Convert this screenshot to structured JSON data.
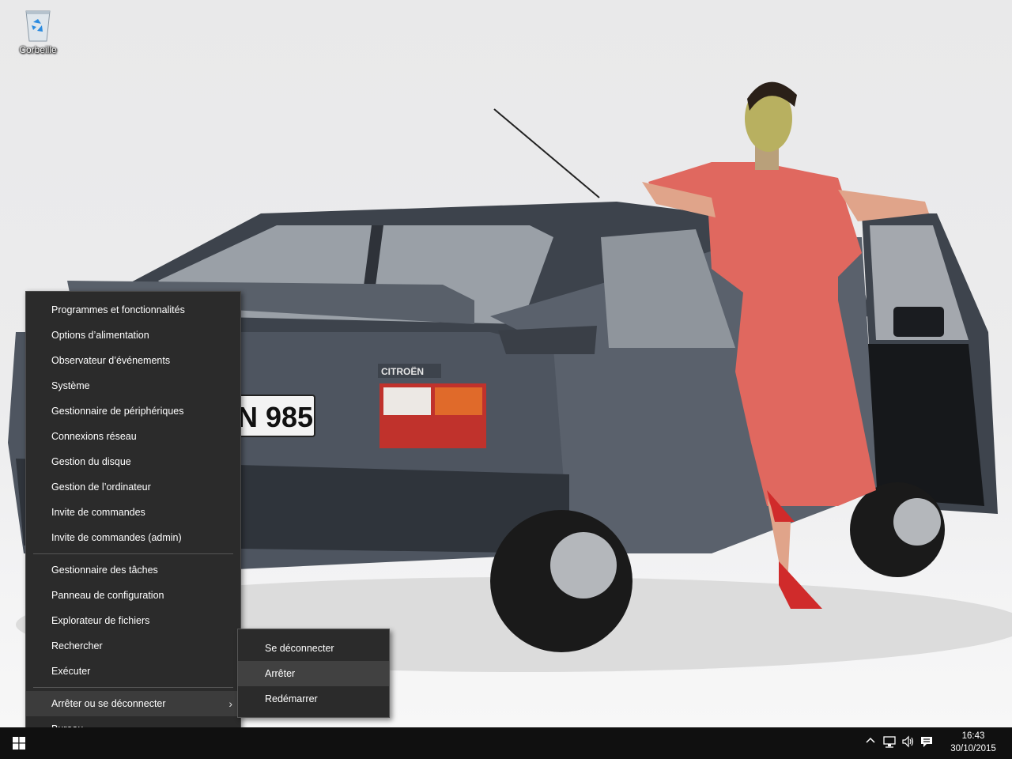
{
  "desktop": {
    "recycle_bin_label": "Corbeille",
    "wallpaper": {
      "car_badge": "CITROËN",
      "license_plate": "N 985"
    }
  },
  "winx_menu": {
    "group1": [
      {
        "label": "Programmes et fonctionnalités"
      },
      {
        "label": "Options d’alimentation"
      },
      {
        "label": "Observateur d’événements"
      },
      {
        "label": "Système"
      },
      {
        "label": "Gestionnaire de périphériques"
      },
      {
        "label": "Connexions réseau"
      },
      {
        "label": "Gestion du disque"
      },
      {
        "label": "Gestion de l’ordinateur"
      },
      {
        "label": "Invite de commandes"
      },
      {
        "label": "Invite de commandes (admin)"
      }
    ],
    "group2": [
      {
        "label": "Gestionnaire des tâches"
      },
      {
        "label": "Panneau de configuration"
      },
      {
        "label": "Explorateur de fichiers"
      },
      {
        "label": "Rechercher"
      },
      {
        "label": "Exécuter"
      }
    ],
    "group3": [
      {
        "label": "Arrêter ou se déconnecter",
        "highlighted": true,
        "has_submenu": true
      },
      {
        "label": "Bureau"
      }
    ]
  },
  "shutdown_submenu": {
    "items": [
      {
        "label": "Se déconnecter"
      },
      {
        "label": "Arrêter",
        "highlighted": true
      },
      {
        "label": "Redémarrer"
      }
    ]
  },
  "taskbar": {
    "start_icon": "windows-logo-icon",
    "tray_icons": [
      "chevron-up-icon",
      "network-icon",
      "volume-icon",
      "action-center-icon"
    ],
    "clock": {
      "time": "16:43",
      "date": "30/10/2015"
    }
  },
  "colors": {
    "menu_bg": "#2b2b2b",
    "menu_highlight": "#3c3c3c",
    "taskbar_bg": "#101010",
    "dress": "#e0685f",
    "car_body": "#4e5560"
  }
}
